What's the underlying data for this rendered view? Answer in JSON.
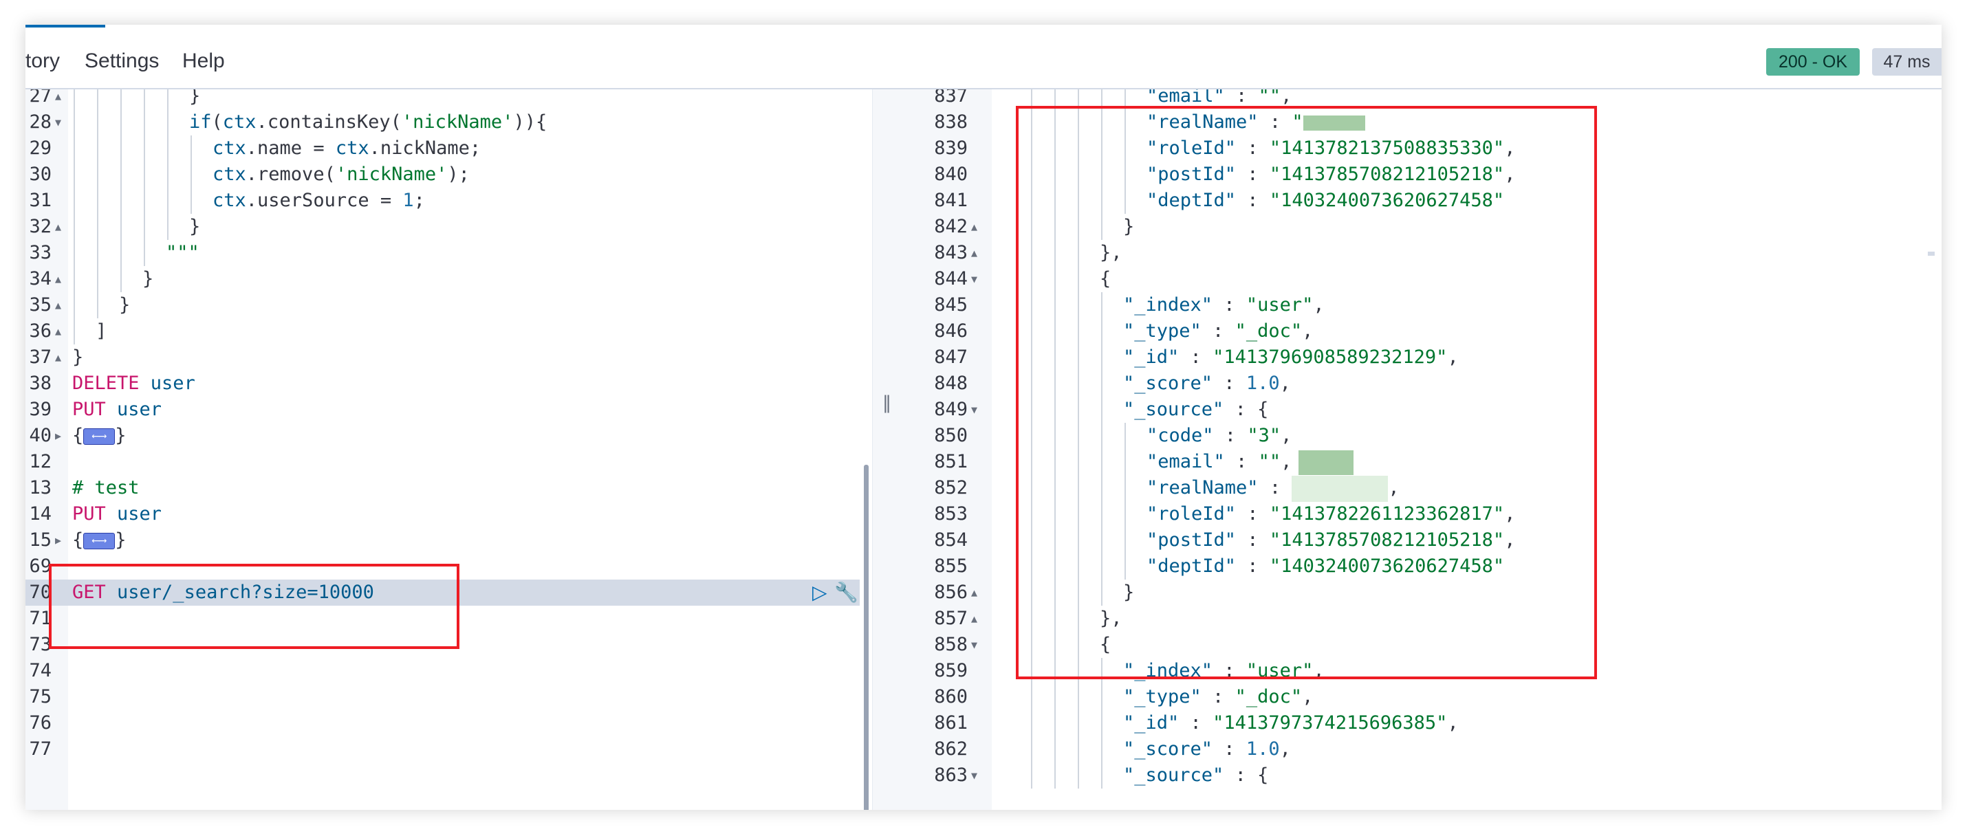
{
  "menu": {
    "history": "tory",
    "settings": "Settings",
    "help": "Help"
  },
  "status": {
    "code": "200 - OK",
    "time": "47 ms"
  },
  "icons": {
    "run": "play-icon",
    "wrench": "wrench-icon",
    "grip": "divider-grip-icon"
  },
  "colors": {
    "status_ok": "#54b399",
    "highlight": "#ee1c24",
    "keyword": "#c8166c",
    "string": "#00762f"
  },
  "request_lines": [
    {
      "ln": "27",
      "fold": "▲",
      "depth": 5,
      "tokens": [
        [
          "}",
          "punc"
        ]
      ]
    },
    {
      "ln": "28",
      "fold": "▼",
      "depth": 5,
      "tokens": [
        [
          "if",
          "ident"
        ],
        [
          "(",
          "punc"
        ],
        [
          "ctx",
          "ident"
        ],
        [
          ".containsKey(",
          "punc"
        ],
        [
          "'nickName'",
          "str"
        ],
        [
          ")){",
          "punc"
        ]
      ]
    },
    {
      "ln": "29",
      "fold": "",
      "depth": 6,
      "tokens": [
        [
          "ctx",
          "ident"
        ],
        [
          ".name = ",
          "punc"
        ],
        [
          "ctx",
          "ident"
        ],
        [
          ".nickName;",
          "punc"
        ]
      ]
    },
    {
      "ln": "30",
      "fold": "",
      "depth": 6,
      "tokens": [
        [
          "ctx",
          "ident"
        ],
        [
          ".remove(",
          "punc"
        ],
        [
          "'nickName'",
          "str"
        ],
        [
          ");",
          "punc"
        ]
      ]
    },
    {
      "ln": "31",
      "fold": "",
      "depth": 6,
      "tokens": [
        [
          "ctx",
          "ident"
        ],
        [
          ".userSource = ",
          "punc"
        ],
        [
          "1",
          "num"
        ],
        [
          ";",
          "punc"
        ]
      ]
    },
    {
      "ln": "32",
      "fold": "▲",
      "depth": 5,
      "tokens": [
        [
          "}",
          "punc"
        ]
      ]
    },
    {
      "ln": "33",
      "fold": "",
      "depth": 4,
      "tokens": [
        [
          "\"\"\"",
          "str"
        ]
      ]
    },
    {
      "ln": "34",
      "fold": "▲",
      "depth": 3,
      "tokens": [
        [
          "}",
          "punc"
        ]
      ]
    },
    {
      "ln": "35",
      "fold": "▲",
      "depth": 2,
      "tokens": [
        [
          "}",
          "punc"
        ]
      ]
    },
    {
      "ln": "36",
      "fold": "▲",
      "depth": 1,
      "tokens": [
        [
          "]",
          "punc"
        ]
      ]
    },
    {
      "ln": "37",
      "fold": "▲",
      "depth": 0,
      "tokens": [
        [
          "}",
          "punc"
        ]
      ]
    },
    {
      "ln": "38",
      "fold": "",
      "depth": 0,
      "tokens": [
        [
          "DELETE ",
          "kw"
        ],
        [
          "user",
          "ident"
        ]
      ]
    },
    {
      "ln": "39",
      "fold": "",
      "depth": 0,
      "tokens": [
        [
          "PUT ",
          "kw"
        ],
        [
          "user",
          "ident"
        ]
      ]
    },
    {
      "ln": "40",
      "fold": "▶",
      "depth": 0,
      "tokens": [
        [
          "{",
          "punc"
        ],
        [
          "⟵⟶",
          "widget"
        ],
        [
          "}",
          "punc"
        ]
      ]
    },
    {
      "ln": "12",
      "fold": "",
      "depth": 0,
      "tokens": []
    },
    {
      "ln": "13",
      "fold": "",
      "depth": 0,
      "tokens": [
        [
          "# test",
          "cmt"
        ]
      ]
    },
    {
      "ln": "14",
      "fold": "",
      "depth": 0,
      "tokens": [
        [
          "PUT ",
          "kw"
        ],
        [
          "user",
          "ident"
        ]
      ]
    },
    {
      "ln": "15",
      "fold": "▶",
      "depth": 0,
      "tokens": [
        [
          "{",
          "punc"
        ],
        [
          "⟵⟶",
          "widget"
        ],
        [
          "}",
          "punc"
        ]
      ]
    },
    {
      "ln": "69",
      "fold": "",
      "depth": 0,
      "tokens": []
    },
    {
      "ln": "70",
      "fold": "",
      "depth": 0,
      "active": true,
      "tokens": [
        [
          "GET ",
          "kw"
        ],
        [
          "user/_search?size=10000",
          "ident"
        ]
      ]
    },
    {
      "ln": "71",
      "fold": "",
      "depth": 0,
      "tokens": []
    },
    {
      "ln": "73",
      "fold": "",
      "depth": 0,
      "tokens": []
    },
    {
      "ln": "74",
      "fold": "",
      "depth": 0,
      "tokens": []
    },
    {
      "ln": "75",
      "fold": "",
      "depth": 0,
      "tokens": []
    },
    {
      "ln": "76",
      "fold": "",
      "depth": 0,
      "tokens": []
    },
    {
      "ln": "77",
      "fold": "",
      "depth": 0,
      "tokens": []
    }
  ],
  "response_lines": [
    {
      "ln": "837",
      "fold": "",
      "depth": 5,
      "tokens": [
        [
          "\"email\"",
          "ident"
        ],
        [
          " : ",
          "punc"
        ],
        [
          "\"\"",
          "str"
        ],
        [
          ",",
          "punc"
        ]
      ]
    },
    {
      "ln": "838",
      "fold": "",
      "depth": 5,
      "tokens": [
        [
          "\"realName\"",
          "ident"
        ],
        [
          " : ",
          "punc"
        ],
        [
          "\"",
          "str"
        ],
        [
          "blur",
          "blur"
        ]
      ]
    },
    {
      "ln": "839",
      "fold": "",
      "depth": 5,
      "tokens": [
        [
          "\"roleId\"",
          "ident"
        ],
        [
          " : ",
          "punc"
        ],
        [
          "\"1413782137508835330\"",
          "str"
        ],
        [
          ",",
          "punc"
        ]
      ]
    },
    {
      "ln": "840",
      "fold": "",
      "depth": 5,
      "tokens": [
        [
          "\"postId\"",
          "ident"
        ],
        [
          " : ",
          "punc"
        ],
        [
          "\"1413785708212105218\"",
          "str"
        ],
        [
          ",",
          "punc"
        ]
      ]
    },
    {
      "ln": "841",
      "fold": "",
      "depth": 5,
      "tokens": [
        [
          "\"deptId\"",
          "ident"
        ],
        [
          " : ",
          "punc"
        ],
        [
          "\"1403240073620627458\"",
          "str"
        ]
      ]
    },
    {
      "ln": "842",
      "fold": "▲",
      "depth": 4,
      "tokens": [
        [
          "}",
          "punc"
        ]
      ]
    },
    {
      "ln": "843",
      "fold": "▲",
      "depth": 3,
      "tokens": [
        [
          "},",
          "punc"
        ]
      ]
    },
    {
      "ln": "844",
      "fold": "▼",
      "depth": 3,
      "tokens": [
        [
          "{",
          "punc"
        ]
      ]
    },
    {
      "ln": "845",
      "fold": "",
      "depth": 4,
      "tokens": [
        [
          "\"_index\"",
          "ident"
        ],
        [
          " : ",
          "punc"
        ],
        [
          "\"user\"",
          "str"
        ],
        [
          ",",
          "punc"
        ]
      ]
    },
    {
      "ln": "846",
      "fold": "",
      "depth": 4,
      "tokens": [
        [
          "\"_type\"",
          "ident"
        ],
        [
          " : ",
          "punc"
        ],
        [
          "\"_doc\"",
          "str"
        ],
        [
          ",",
          "punc"
        ]
      ]
    },
    {
      "ln": "847",
      "fold": "",
      "depth": 4,
      "tokens": [
        [
          "\"_id\"",
          "ident"
        ],
        [
          " : ",
          "punc"
        ],
        [
          "\"1413796908589232129\"",
          "str"
        ],
        [
          ",",
          "punc"
        ]
      ]
    },
    {
      "ln": "848",
      "fold": "",
      "depth": 4,
      "tokens": [
        [
          "\"_score\"",
          "ident"
        ],
        [
          " : ",
          "punc"
        ],
        [
          "1.0",
          "num"
        ],
        [
          ",",
          "punc"
        ]
      ]
    },
    {
      "ln": "849",
      "fold": "▼",
      "depth": 4,
      "tokens": [
        [
          "\"_source\"",
          "ident"
        ],
        [
          " : {",
          "punc"
        ]
      ]
    },
    {
      "ln": "850",
      "fold": "",
      "depth": 5,
      "tokens": [
        [
          "\"code\"",
          "ident"
        ],
        [
          " : ",
          "punc"
        ],
        [
          "\"3\"",
          "str"
        ],
        [
          ",",
          "punc"
        ]
      ]
    },
    {
      "ln": "851",
      "fold": "",
      "depth": 5,
      "tokens": [
        [
          "\"email\"",
          "ident"
        ],
        [
          " : ",
          "punc"
        ],
        [
          "\"\"",
          "str"
        ],
        [
          ",",
          "punc"
        ],
        [
          "blur2",
          "blur"
        ]
      ]
    },
    {
      "ln": "852",
      "fold": "",
      "depth": 5,
      "tokens": [
        [
          "\"realName\"",
          "ident"
        ],
        [
          " : ",
          "punc"
        ],
        [
          "blur3",
          "blur"
        ],
        [
          ",",
          "punc"
        ]
      ]
    },
    {
      "ln": "853",
      "fold": "",
      "depth": 5,
      "tokens": [
        [
          "\"roleId\"",
          "ident"
        ],
        [
          " : ",
          "punc"
        ],
        [
          "\"1413782261123362817\"",
          "str"
        ],
        [
          ",",
          "punc"
        ]
      ]
    },
    {
      "ln": "854",
      "fold": "",
      "depth": 5,
      "tokens": [
        [
          "\"postId\"",
          "ident"
        ],
        [
          " : ",
          "punc"
        ],
        [
          "\"1413785708212105218\"",
          "str"
        ],
        [
          ",",
          "punc"
        ]
      ]
    },
    {
      "ln": "855",
      "fold": "",
      "depth": 5,
      "tokens": [
        [
          "\"deptId\"",
          "ident"
        ],
        [
          " : ",
          "punc"
        ],
        [
          "\"1403240073620627458\"",
          "str"
        ]
      ]
    },
    {
      "ln": "856",
      "fold": "▲",
      "depth": 4,
      "tokens": [
        [
          "}",
          "punc"
        ]
      ]
    },
    {
      "ln": "857",
      "fold": "▲",
      "depth": 3,
      "tokens": [
        [
          "},",
          "punc"
        ]
      ]
    },
    {
      "ln": "858",
      "fold": "▼",
      "depth": 3,
      "tokens": [
        [
          "{",
          "punc"
        ]
      ]
    },
    {
      "ln": "859",
      "fold": "",
      "depth": 4,
      "tokens": [
        [
          "\"_index\"",
          "ident"
        ],
        [
          " : ",
          "punc"
        ],
        [
          "\"user\"",
          "str"
        ],
        [
          ",",
          "punc"
        ]
      ]
    },
    {
      "ln": "860",
      "fold": "",
      "depth": 4,
      "tokens": [
        [
          "\"_type\"",
          "ident"
        ],
        [
          " : ",
          "punc"
        ],
        [
          "\"_doc\"",
          "str"
        ],
        [
          ",",
          "punc"
        ]
      ]
    },
    {
      "ln": "861",
      "fold": "",
      "depth": 4,
      "tokens": [
        [
          "\"_id\"",
          "ident"
        ],
        [
          " : ",
          "punc"
        ],
        [
          "\"1413797374215696385\"",
          "str"
        ],
        [
          ",",
          "punc"
        ]
      ]
    },
    {
      "ln": "862",
      "fold": "",
      "depth": 4,
      "tokens": [
        [
          "\"_score\"",
          "ident"
        ],
        [
          " : ",
          "punc"
        ],
        [
          "1.0",
          "num"
        ],
        [
          ",",
          "punc"
        ]
      ]
    },
    {
      "ln": "863",
      "fold": "▼",
      "depth": 4,
      "tokens": [
        [
          "\"_source\"",
          "ident"
        ],
        [
          " : {",
          "punc"
        ]
      ]
    }
  ]
}
